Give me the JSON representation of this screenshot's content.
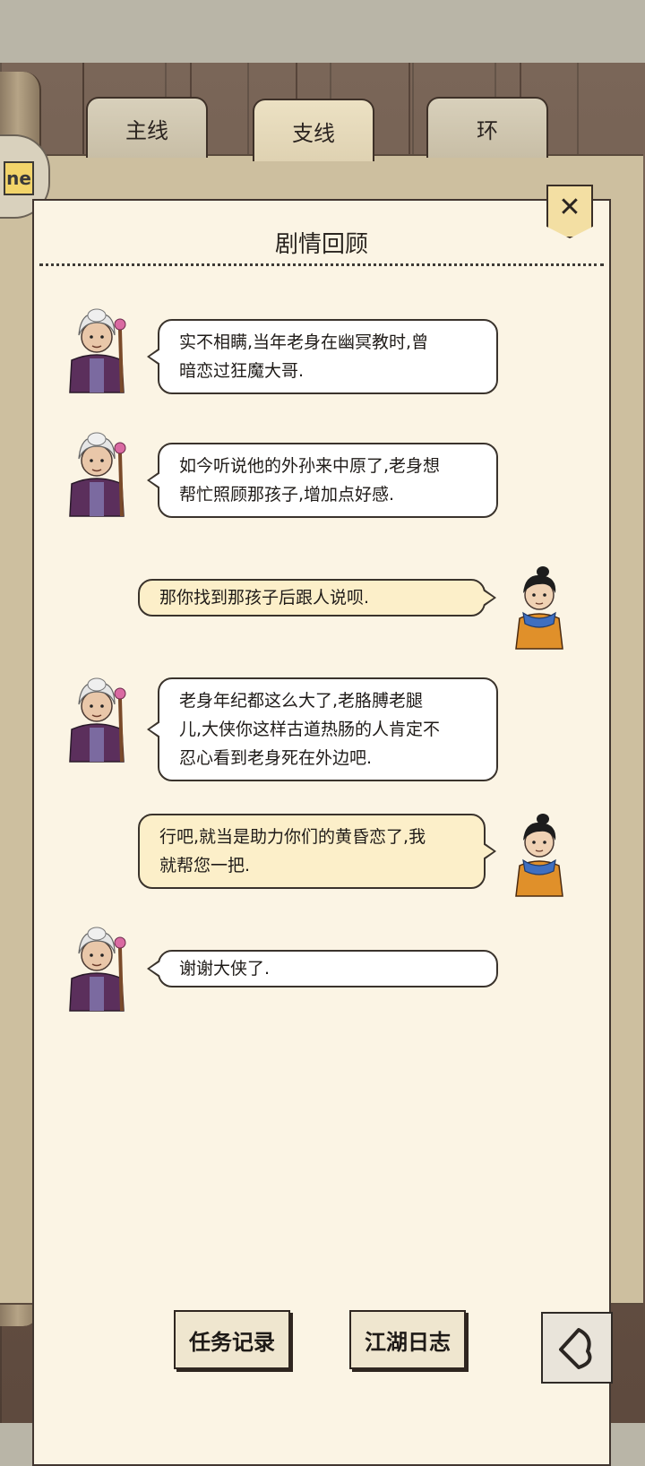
{
  "tabs": [
    {
      "label": "主线",
      "active": false
    },
    {
      "label": "支线",
      "active": true
    },
    {
      "label": "环",
      "active": false
    }
  ],
  "side_badge": {
    "text": "ne"
  },
  "panel": {
    "title": "剧情回顾",
    "close_icon": "close-icon"
  },
  "dialogue": [
    {
      "speaker": "old-woman",
      "side": "left",
      "text": "实不相瞒,当年老身在幽冥教时,曾\n暗恋过狂魔大哥."
    },
    {
      "speaker": "old-woman",
      "side": "left",
      "text": "如今听说他的外孙来中原了,老身想\n帮忙照顾那孩子,增加点好感."
    },
    {
      "speaker": "hero",
      "side": "right",
      "text": "那你找到那孩子后跟人说呗."
    },
    {
      "speaker": "old-woman",
      "side": "left",
      "text": "老身年纪都这么大了,老胳膊老腿\n儿,大侠你这样古道热肠的人肯定不\n忍心看到老身死在外边吧."
    },
    {
      "speaker": "hero",
      "side": "right",
      "text": "行吧,就当是助力你们的黄昏恋了,我\n就帮您一把."
    },
    {
      "speaker": "old-woman",
      "side": "left",
      "text": "谢谢大侠了."
    }
  ],
  "bottom": {
    "task_log": "任务记录",
    "jianghu_diary": "江湖日志",
    "back_icon": "back-arrow-icon"
  },
  "colors": {
    "paper": "#fbf4e4",
    "wood": "#6b5649",
    "bubble_right": "#fcefc9",
    "close_button": "#f3dfa3"
  }
}
